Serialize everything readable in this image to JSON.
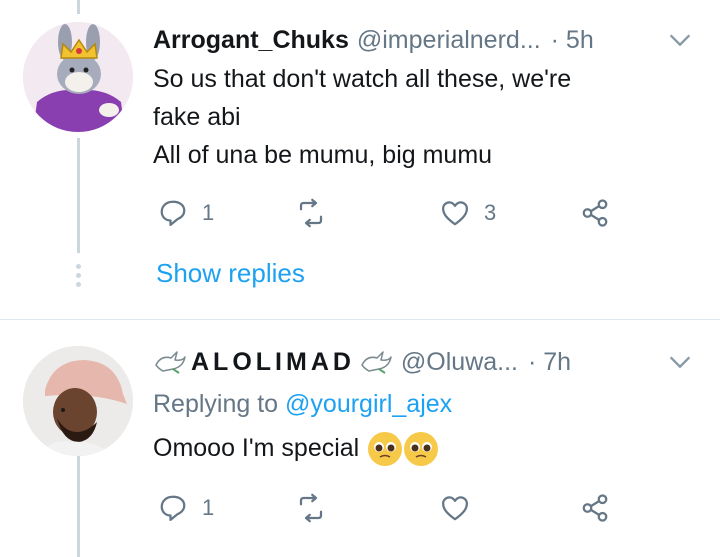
{
  "tweet1": {
    "author_name": "Arrogant_Chuks",
    "handle": "@imperialnerd...",
    "time": "· 5h",
    "lines": [
      "So us that don't watch all these, we're",
      "fake abi",
      "All of una be mumu, big mumu"
    ],
    "reply_count": "1",
    "retweet_count": "",
    "like_count": "3",
    "show_replies": "Show replies"
  },
  "tweet2": {
    "author_name": "ALOLIMAD",
    "handle": "@Oluwa...",
    "time": "· 7h",
    "replying_prefix": "Replying to ",
    "replying_to": "@yourgirl_ajex",
    "text": "Omooo I'm special",
    "emojis": [
      "pleading-face",
      "pleading-face"
    ],
    "reply_count": "1",
    "retweet_count": "",
    "like_count": ""
  },
  "colors": {
    "accent": "#1da1f2",
    "muted": "#657786",
    "text": "#14171a",
    "thread_line": "#ccd6dd",
    "divider": "#e1e8ed"
  },
  "icons": [
    "reply-icon",
    "retweet-icon",
    "like-icon",
    "share-icon",
    "chevron-down-icon",
    "dove-icon",
    "pleading-face-emoji"
  ]
}
